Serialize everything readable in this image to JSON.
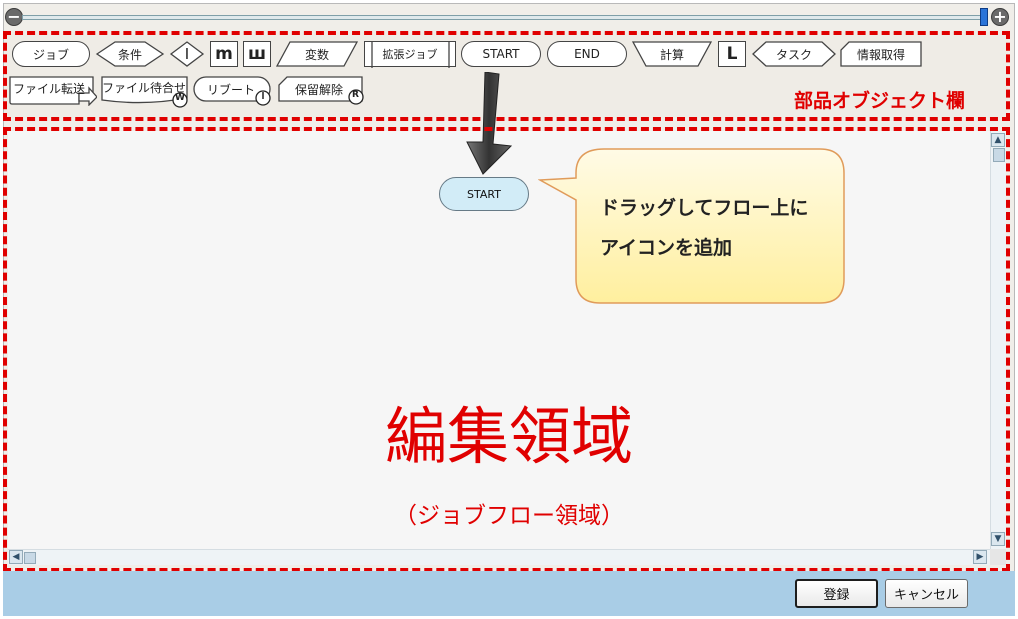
{
  "palette": {
    "section_label": "部品オブジェクト欄",
    "items": [
      {
        "label": "ジョブ",
        "shape": "pill"
      },
      {
        "label": "条件",
        "shape": "diamond"
      },
      {
        "label": "I",
        "shape": "diamond-letter"
      },
      {
        "label": "m",
        "shape": "box-letter"
      },
      {
        "label": "ш",
        "shape": "box-letter"
      },
      {
        "label": "変数",
        "shape": "parallelogram"
      },
      {
        "label": "拡張ジョブ",
        "shape": "double-bar"
      },
      {
        "label": "START",
        "shape": "pill"
      },
      {
        "label": "END",
        "shape": "pill"
      },
      {
        "label": "計算",
        "shape": "trapezoid"
      },
      {
        "label": "L",
        "shape": "box-letter"
      },
      {
        "label": "タスク",
        "shape": "hexagon"
      },
      {
        "label": "情報取得",
        "shape": "cut-corner"
      },
      {
        "label": "ファイル転送",
        "shape": "arrow-badge"
      },
      {
        "label": "ファイル待合せ",
        "shape": "w-badge"
      },
      {
        "label": "リブート",
        "shape": "power-badge"
      },
      {
        "label": "保留解除",
        "shape": "r-badge"
      }
    ],
    "badges": {
      "w": "W",
      "r": "R"
    }
  },
  "editor": {
    "title": "編集領域",
    "subtitle": "（ジョブフロー領域）",
    "start_node": "START",
    "callout_line1": "ドラッグしてフロー上に",
    "callout_line2": "アイコンを追加"
  },
  "buttons": {
    "register": "登録",
    "cancel": "キャンセル"
  },
  "colors": {
    "annotation": "#e00000",
    "start_fill": "#d2ecf7",
    "callout_fill": "#fff6c9",
    "callout_border": "#e0a060",
    "footer": "#a9cde6"
  },
  "zoom": {
    "level_fraction": 0.99
  }
}
